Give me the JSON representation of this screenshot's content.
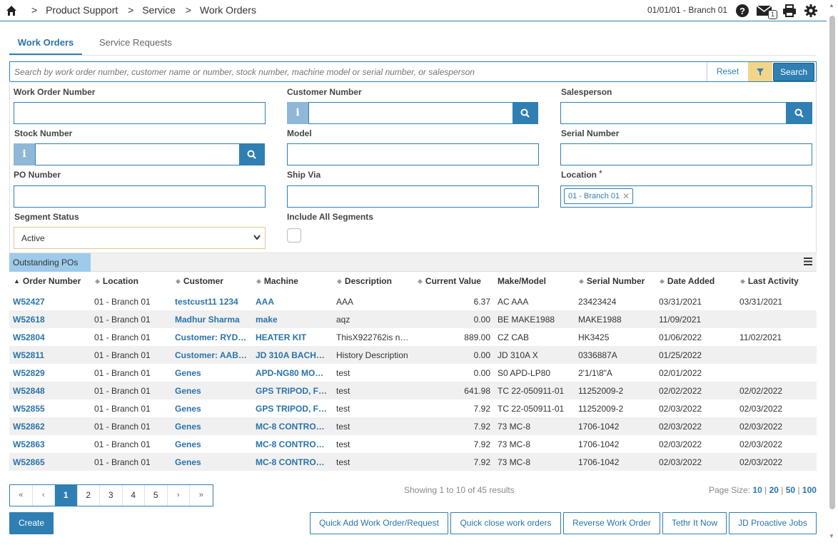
{
  "topbar": {
    "breadcrumbs": [
      ">",
      "Product Support",
      ">",
      "Service",
      ">",
      "Work Orders"
    ],
    "branch": "01/01/01 - Branch 01",
    "mail_count": "1",
    "icons": [
      "home-icon",
      "help-icon",
      "mail-icon",
      "print-icon",
      "gear-icon"
    ]
  },
  "tabs": [
    "Work Orders",
    "Service Requests"
  ],
  "search": {
    "placeholder": "Search by work order number, customer name or number, stock number, machine model or serial number, or salesperson",
    "reset_label": "Reset",
    "search_label": "Search"
  },
  "filters": {
    "work_order_number": "Work Order Number",
    "customer_number": "Customer Number",
    "salesperson": "Salesperson",
    "stock_number": "Stock Number",
    "model": "Model",
    "serial_number": "Serial Number",
    "po_number": "PO Number",
    "ship_via": "Ship Via",
    "location": "Location",
    "location_required": "*",
    "location_tag": "01 - Branch 01",
    "segment_status": "Segment Status",
    "segment_status_value": "Active",
    "include_all_segments": "Include All Segments",
    "info_glyph": "i"
  },
  "grid": {
    "title": "Outstanding POs",
    "columns": [
      "Order Number",
      "Location",
      "Customer",
      "Machine",
      "Description",
      "Current Value",
      "Make/Model",
      "Serial Number",
      "Date Added",
      "Last Activity"
    ],
    "rows": [
      [
        "W52427",
        "01 - Branch 01",
        "testcust11 1234",
        "AAA",
        "AAA",
        "6.37",
        "AC AAA",
        "23423424",
        "03/31/2021",
        "03/31/2021"
      ],
      [
        "W52618",
        "01 - Branch 01",
        "Madhur Sharma",
        "make",
        "aqz",
        "0.00",
        "BE MAKE1988",
        "MAKE1988",
        "11/09/2021",
        ""
      ],
      [
        "W52804",
        "01 - Branch 01",
        "Customer: RYD…",
        "HEATER KIT",
        "ThisX922762is n…",
        "889.00",
        "CZ CAB",
        "HK3425",
        "01/06/2022",
        "11/02/2021"
      ],
      [
        "W52811",
        "01 - Branch 01",
        "Customer: AAB…",
        "JD 310A BACH…",
        "History Description",
        "0.00",
        "JD 310A X",
        "0336887A",
        "01/25/2022",
        ""
      ],
      [
        "W52829",
        "01 - Branch 01",
        "Genes",
        "APD-NG80 MO…",
        "test",
        "0.00",
        "S0 APD-LP80",
        "2'1/1\\8\"A",
        "02/01/2022",
        ""
      ],
      [
        "W52848",
        "01 - Branch 01",
        "Genes",
        "GPS TRIPOD, F…",
        "test",
        "641.98",
        "TC 22-050911-01",
        "11252009-2",
        "02/02/2022",
        "02/02/2022"
      ],
      [
        "W52855",
        "01 - Branch 01",
        "Genes",
        "GPS TRIPOD, F…",
        "test",
        "7.92",
        "TC 22-050911-01",
        "11252009-2",
        "02/03/2022",
        "02/03/2022"
      ],
      [
        "W52862",
        "01 - Branch 01",
        "Genes",
        "MC-8 CONTRO…",
        "test",
        "7.92",
        "73 MC-8",
        "1706-1042",
        "02/03/2022",
        "02/03/2022"
      ],
      [
        "W52863",
        "01 - Branch 01",
        "Genes",
        "MC-8 CONTRO…",
        "test",
        "7.92",
        "73 MC-8",
        "1706-1042",
        "02/03/2022",
        "02/03/2022"
      ],
      [
        "W52865",
        "01 - Branch 01",
        "Genes",
        "MC-8 CONTRO…",
        "test",
        "7.92",
        "73 MC-8",
        "1706-1042",
        "02/03/2022",
        "02/03/2022"
      ]
    ]
  },
  "pagination": {
    "pages": [
      "«",
      "‹",
      "1",
      "2",
      "3",
      "4",
      "5",
      "›",
      "»"
    ],
    "active_page": "1",
    "showing": "Showing 1 to 10 of 45 results",
    "page_size_label": "Page Size:",
    "page_sizes": [
      "10",
      "20",
      "50",
      "100"
    ],
    "separator": "|"
  },
  "actions": {
    "create": "Create",
    "quick_add": "Quick Add Work Order/Request",
    "quick_close": "Quick close work orders",
    "reverse": "Reverse Work Order",
    "tethr": "Tethr It Now",
    "jd_proactive": "JD Proactive Jobs"
  },
  "colors": {
    "accent": "#2f7fb3",
    "link": "#2a74a9",
    "filter_button": "#f2d58a",
    "grid_title_bg": "#9ecbea",
    "row_alt": "#f0f0f0"
  }
}
